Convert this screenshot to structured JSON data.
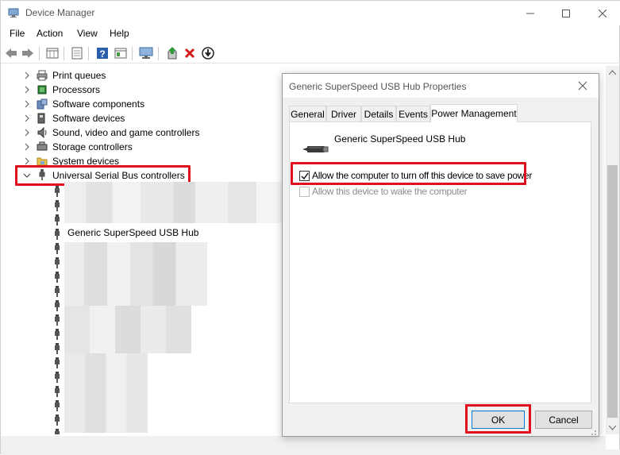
{
  "window": {
    "title": "Device Manager"
  },
  "menu": [
    "File",
    "Action",
    "View",
    "Help"
  ],
  "toolbar": {
    "icons": [
      "back-arrow-icon",
      "forward-arrow-icon",
      "properties-grid-icon",
      "document-icon",
      "help-icon",
      "refresh-grid-icon",
      "monitor-scan-icon",
      "update-driver-icon",
      "uninstall-x-icon",
      "download-circle-icon"
    ]
  },
  "tree": {
    "categories": [
      {
        "label": "Print queues",
        "icon": "printer-icon"
      },
      {
        "label": "Processors",
        "icon": "chip-icon"
      },
      {
        "label": "Software components",
        "icon": "puzzle-icon"
      },
      {
        "label": "Software devices",
        "icon": "software-device-icon"
      },
      {
        "label": "Sound, video and game controllers",
        "icon": "speaker-icon"
      },
      {
        "label": "Storage controllers",
        "icon": "storage-icon"
      },
      {
        "label": "System devices",
        "icon": "system-folder-icon"
      }
    ],
    "expanded": {
      "label": "Universal Serial Bus controllers",
      "icon": "usb-icon"
    },
    "visible_child": "Generic SuperSpeed USB Hub"
  },
  "dialog": {
    "title": "Generic SuperSpeed USB Hub Properties",
    "tabs": [
      "General",
      "Driver",
      "Details",
      "Events",
      "Power Management"
    ],
    "active_tab": "Power Management",
    "device_name": "Generic SuperSpeed USB Hub",
    "checkbox_turn_off": {
      "label": "Allow the computer to turn off this device to save power",
      "checked": true
    },
    "checkbox_wake": {
      "label": "Allow this device to wake the computer",
      "checked": false,
      "disabled": true
    },
    "ok_label": "OK",
    "cancel_label": "Cancel"
  },
  "colors": {
    "highlight": "#e0101e",
    "accent": "#0078d7"
  }
}
